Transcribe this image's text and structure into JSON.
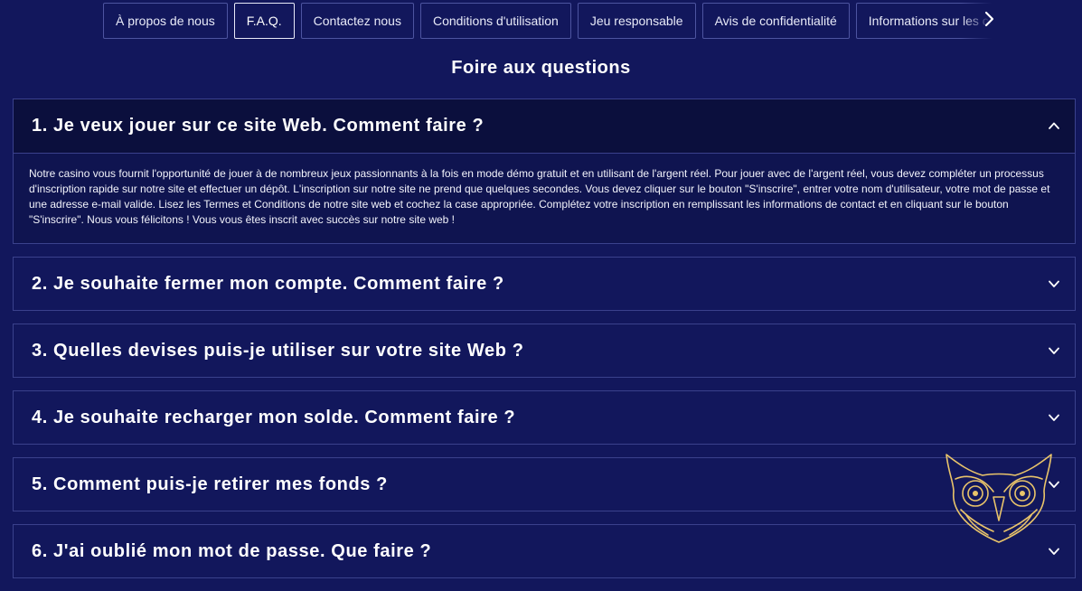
{
  "nav": {
    "tabs": [
      {
        "label": "À propos de nous",
        "active": false
      },
      {
        "label": "F.A.Q.",
        "active": true
      },
      {
        "label": "Contactez nous",
        "active": false
      },
      {
        "label": "Conditions d'utilisation",
        "active": false
      },
      {
        "label": "Jeu responsable",
        "active": false
      },
      {
        "label": "Avis de confidentialité",
        "active": false
      },
      {
        "label": "Informations sur les cookies",
        "active": false
      }
    ],
    "next_icon": "chevron-right-icon"
  },
  "page": {
    "title": "Foire aux questions"
  },
  "faq": {
    "items": [
      {
        "question": "1. Je veux jouer sur ce site Web. Comment faire ?",
        "expanded": true,
        "answer": "Notre casino vous fournit l'opportunité de jouer à de nombreux jeux passionnants à la fois en mode démo gratuit et en utilisant de l'argent réel. Pour jouer avec de l'argent réel, vous devez compléter un processus d'inscription rapide sur notre site et effectuer un dépôt. L'inscription sur notre site ne prend que quelques secondes. Vous devez cliquer sur le bouton \"S'inscrire\", entrer votre nom d'utilisateur, votre mot de passe et une adresse e-mail valide. Lisez les Termes et Conditions de notre site web et cochez la case appropriée. Complétez votre inscription en remplissant les informations de contact et en cliquant sur le bouton \"S'inscrire\". Nous vous félicitons ! Vous vous êtes inscrit avec succès sur notre site web !"
      },
      {
        "question": "2. Je souhaite fermer mon compte. Comment faire ?",
        "expanded": false
      },
      {
        "question": "3. Quelles devises puis-je utiliser sur votre site Web ?",
        "expanded": false
      },
      {
        "question": "4. Je souhaite recharger mon solde. Comment faire ?",
        "expanded": false
      },
      {
        "question": "5. Comment puis-je retirer mes fonds ?",
        "expanded": false
      },
      {
        "question": "6. J'ai oublié mon mot de passe. Que faire ?",
        "expanded": false
      }
    ],
    "expand_icon": "chevron-down-icon",
    "collapse_icon": "chevron-up-icon"
  },
  "logo": {
    "icon": "owl-logo",
    "color": "#e9c46a"
  },
  "colors": {
    "background": "#12175c",
    "border": "#3a418c",
    "text": "#ffffff"
  }
}
